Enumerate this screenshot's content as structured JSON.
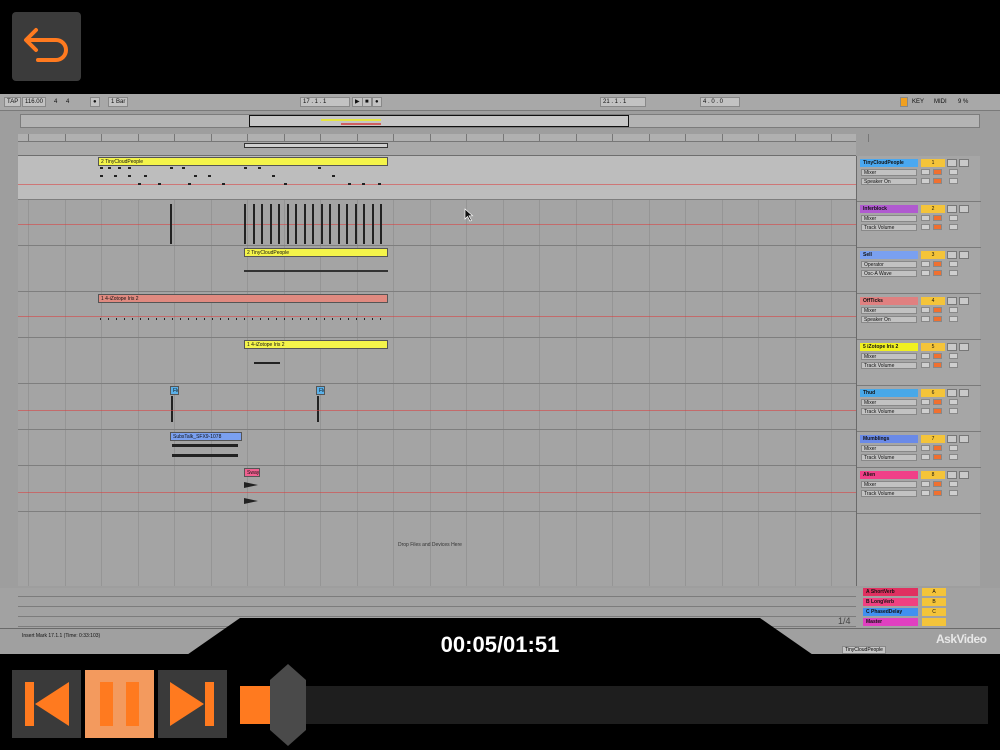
{
  "colors": {
    "accent": "#ff7a1f",
    "transport_button": "#3a3a3a",
    "active_button": "#f39a5e",
    "daw_background": "#9e9e9e"
  },
  "back_button": {
    "icon": "back-arrow-icon"
  },
  "control_bar": {
    "tap": "TAP",
    "tempo": "116.00",
    "time_sig_num": "4",
    "time_sig_den": "4",
    "quantize": "1 Bar",
    "position": "17 . 1 . 1",
    "loop_start": "21 . 1 . 1",
    "loop_length": "4 . 0 . 0",
    "key": "KEY",
    "midi": "MIDI",
    "cpu": "9 %"
  },
  "arrangement": {
    "drop_text": "Drop Files and Devices Here",
    "clips": [
      "2 TinyCloudPeople",
      "2 TinyCloudPeople",
      "1 4-iZotope Iris 2",
      "1 4-iZotope Iris 2",
      "Flo",
      "Flo",
      "SubsTalk_SFX9-1078",
      "Sway"
    ]
  },
  "tracks": [
    {
      "name": "TinyCloudPeople",
      "num": "1",
      "color": "#4aa8f0",
      "device": "Mixer",
      "param": "Speaker On"
    },
    {
      "name": "Inferblock",
      "num": "2",
      "color": "#b05ad0",
      "device": "Mixer",
      "param": "Track Volume"
    },
    {
      "name": "Sell",
      "num": "3",
      "color": "#7aa0f0",
      "device": "Operator",
      "param": "Osc-A Wave"
    },
    {
      "name": "OffTicks",
      "num": "4",
      "color": "#e08080",
      "device": "Mixer",
      "param": "Speaker On"
    },
    {
      "name": "5 iZotope Iris 2",
      "num": "5",
      "color": "#f0f020",
      "device": "Mixer",
      "param": "Track Volume"
    },
    {
      "name": "Thud",
      "num": "6",
      "color": "#48a8e8",
      "device": "Mixer",
      "param": "Track Volume"
    },
    {
      "name": "Mumblings",
      "num": "7",
      "color": "#6a8ae8",
      "device": "Mixer",
      "param": "Track Volume"
    },
    {
      "name": "Alien",
      "num": "8",
      "color": "#f04088",
      "device": "Mixer",
      "param": "Track Volume"
    }
  ],
  "returns": [
    {
      "name": "A ShortVerb",
      "num": "A",
      "color": "#e03060"
    },
    {
      "name": "B LongVerb",
      "num": "B",
      "color": "#f04080"
    },
    {
      "name": "C PhasedDelay",
      "num": "C",
      "color": "#4090f0"
    },
    {
      "name": "Master",
      "num": "",
      "color": "#e040c0"
    }
  ],
  "status": {
    "insert_mark": "Insert Mark 17.1.1 (Time: 0:33:103)",
    "track_name": "TinyCloudPeople",
    "page": "1/4"
  },
  "watermark": "AskVideo",
  "player": {
    "time": "00:05/01:51",
    "progress_fraction": 0.045,
    "prev_icon": "skip-back-icon",
    "pause_icon": "pause-icon",
    "next_icon": "skip-forward-icon"
  }
}
